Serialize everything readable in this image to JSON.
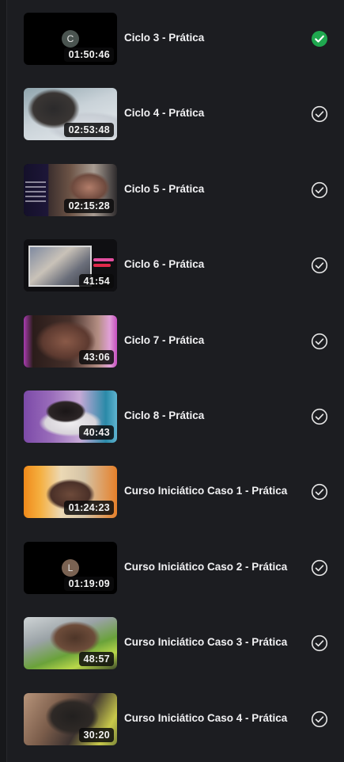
{
  "lessons": [
    {
      "title": "Ciclo 3 - Prática",
      "duration": "01:50:46",
      "completed_active": true,
      "thumb": "placeholder",
      "letter": "C",
      "letter_color": "#4a5450"
    },
    {
      "title": "Ciclo 4 - Prática",
      "duration": "02:53:48",
      "completed_active": false,
      "thumb": "photo-head"
    },
    {
      "title": "Ciclo 5 - Prática",
      "duration": "02:15:28",
      "completed_active": false,
      "thumb": "photo-mentoria"
    },
    {
      "title": "Ciclo 6 - Prática",
      "duration": "41:54",
      "completed_active": false,
      "thumb": "photo-webcam"
    },
    {
      "title": "Ciclo 7 - Prática",
      "duration": "43:06",
      "completed_active": false,
      "thumb": "photo-pink"
    },
    {
      "title": "Ciclo 8 - Prática",
      "duration": "40:43",
      "completed_active": false,
      "thumb": "photo-purple"
    },
    {
      "title": "Curso Iniciático Caso 1 - Prática",
      "duration": "01:24:23",
      "completed_active": false,
      "thumb": "photo-orange"
    },
    {
      "title": "Curso Iniciático Caso 2 - Prática",
      "duration": "01:19:09",
      "completed_active": false,
      "thumb": "placeholder",
      "letter": "L",
      "letter_color": "#7a6252"
    },
    {
      "title": "Curso Iniciático Caso 3 - Prática",
      "duration": "48:57",
      "completed_active": false,
      "thumb": "photo-green"
    },
    {
      "title": "Curso Iniciático Caso 4 - Prática",
      "duration": "30:20",
      "completed_active": false,
      "thumb": "photo-dark"
    }
  ],
  "colors": {
    "background": "#1c1d21",
    "check_active": "#1fa84f",
    "check_outline": "#e6e6e6",
    "title_text": "#f1f1f3"
  },
  "icons": {
    "completed": "check-circle-filled-icon",
    "done": "check-circle-outline-icon"
  }
}
